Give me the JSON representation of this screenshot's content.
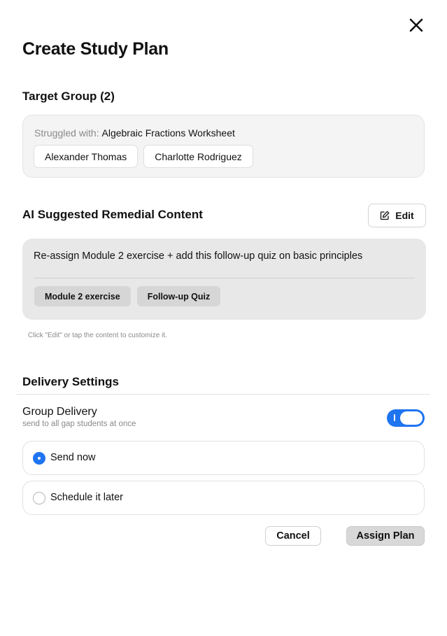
{
  "dialog": {
    "title": "Create Study Plan",
    "close_icon": "close-icon"
  },
  "target_group": {
    "heading": "Target Group (2)",
    "struggled_label": "Struggled with:",
    "struggled_value": "Algebraic Fractions Worksheet",
    "students": [
      "Alexander Thomas",
      "Charlotte Rodriguez"
    ]
  },
  "remedial": {
    "heading": "AI Suggested Remedial Content",
    "edit_label": "Edit",
    "edit_icon": "edit-icon",
    "text": "Re-assign Module 2 exercise + add this follow-up quiz on basic principles",
    "items": [
      "Module 2 exercise",
      "Follow-up Quiz"
    ],
    "hint": "Click \"Edit\" or tap the content to customize it."
  },
  "delivery": {
    "heading": "Delivery Settings",
    "group_title": "Group Delivery",
    "group_subtitle": "send to all gap students at once",
    "group_enabled": true,
    "options": [
      {
        "label": "Send now",
        "selected": true
      },
      {
        "label": "Schedule it later",
        "selected": false
      }
    ]
  },
  "actions": {
    "cancel_label": "Cancel",
    "assign_label": "Assign Plan"
  },
  "colors": {
    "accent": "#1f74f0",
    "card_bg": "#f4f4f4",
    "remedial_bg": "#e8e8e8",
    "muted_text": "#8a8a8a"
  }
}
